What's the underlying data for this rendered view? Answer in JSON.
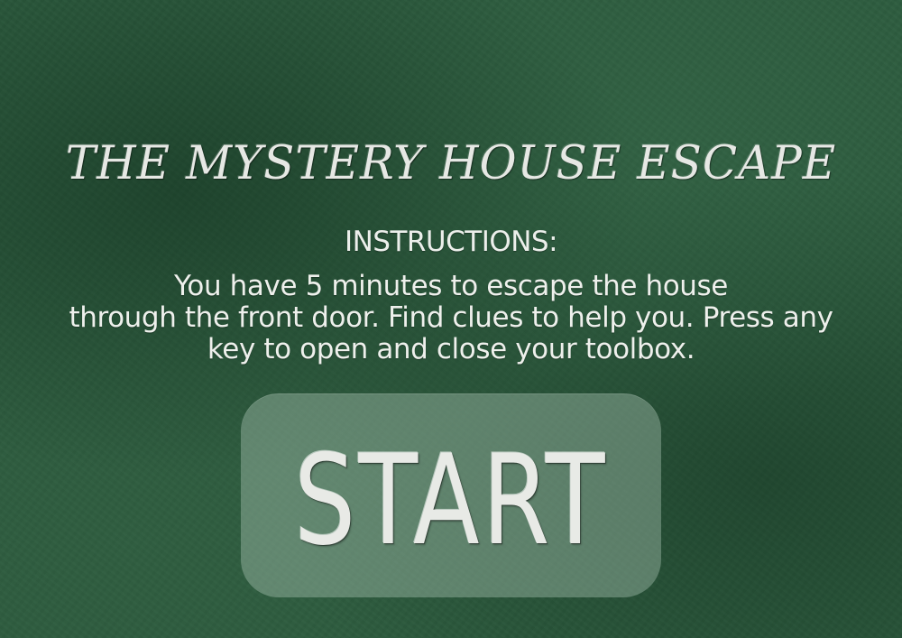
{
  "game": {
    "title": "THE MYSTERY HOUSE ESCAPE",
    "instructions": {
      "heading": "INSTRUCTIONS:",
      "lines": [
        "You have 5 minutes to escape the house",
        "through the front door. Find clues to help you. Press any",
        "key to open and close your toolbox."
      ]
    },
    "start_button": {
      "label": "START"
    }
  },
  "colors": {
    "background": "#2c5a3d",
    "text": "#e8eae6",
    "button_fill": "rgba(170,195,178,0.42)"
  }
}
